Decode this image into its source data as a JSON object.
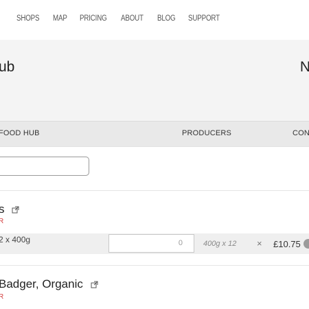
{
  "nav": {
    "items": [
      "SHOPS",
      "MAP",
      "PRICING",
      "ABOUT",
      "BLOG",
      "SUPPORT"
    ]
  },
  "hero": {
    "title_partial": "ub",
    "right_partial": "N"
  },
  "subnav": {
    "left": "FOOD HUB",
    "center": "PRODUCERS",
    "right": "CONTA"
  },
  "products": [
    {
      "title": "s",
      "red_text": "R",
      "variant": "2 x 400g",
      "quantity_placeholder": "0",
      "unit": "400g x 12",
      "times": "×",
      "price": "£10.75"
    },
    {
      "title": "Badger, Organic",
      "red_text": "R"
    }
  ],
  "icons": {
    "external_link": "external-link-icon"
  }
}
